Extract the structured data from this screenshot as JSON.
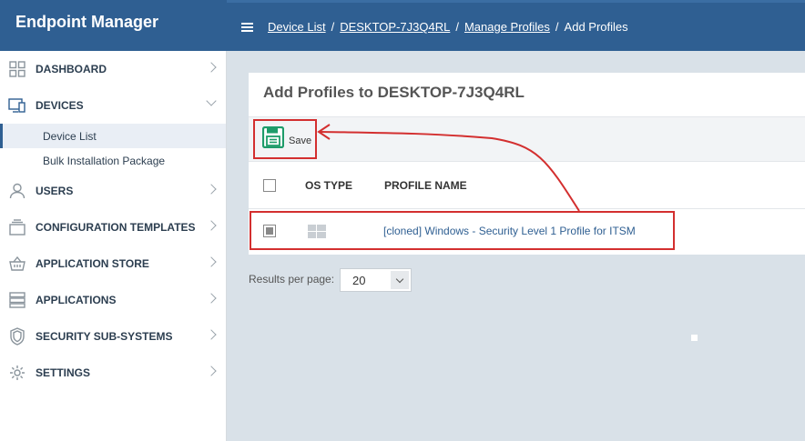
{
  "app": {
    "title": "Endpoint Manager"
  },
  "breadcrumb": [
    "Device List",
    "DESKTOP-7J3Q4RL",
    "Manage Profiles"
  ],
  "breadcrumb_current": "Add Profiles",
  "sidebar": {
    "items": [
      {
        "label": "DASHBOARD",
        "icon": "dashboard-grid-icon"
      },
      {
        "label": "DEVICES",
        "icon": "devices-icon",
        "expanded": true
      },
      {
        "label": "USERS",
        "icon": "user-icon"
      },
      {
        "label": "CONFIGURATION TEMPLATES",
        "icon": "templates-icon"
      },
      {
        "label": "APPLICATION STORE",
        "icon": "basket-icon"
      },
      {
        "label": "APPLICATIONS",
        "icon": "applications-icon"
      },
      {
        "label": "SECURITY SUB-SYSTEMS",
        "icon": "shield-icon"
      },
      {
        "label": "SETTINGS",
        "icon": "gear-icon"
      }
    ],
    "devices_sub": [
      {
        "label": "Device List",
        "active": true
      },
      {
        "label": "Bulk Installation Package"
      }
    ]
  },
  "main": {
    "title": "Add Profiles to DESKTOP-7J3Q4RL",
    "save_label": "Save",
    "columns": [
      "OS TYPE",
      "PROFILE NAME"
    ],
    "rows": [
      {
        "os": "windows-icon",
        "profile": "[cloned] Windows - Security Level 1 Profile for ITSM"
      }
    ],
    "results_label": "Results per page:",
    "results_value": "20"
  },
  "colors": {
    "brand": "#2f5f92",
    "highlight": "#d32f2f",
    "save_icon": "#1e9c6a"
  }
}
